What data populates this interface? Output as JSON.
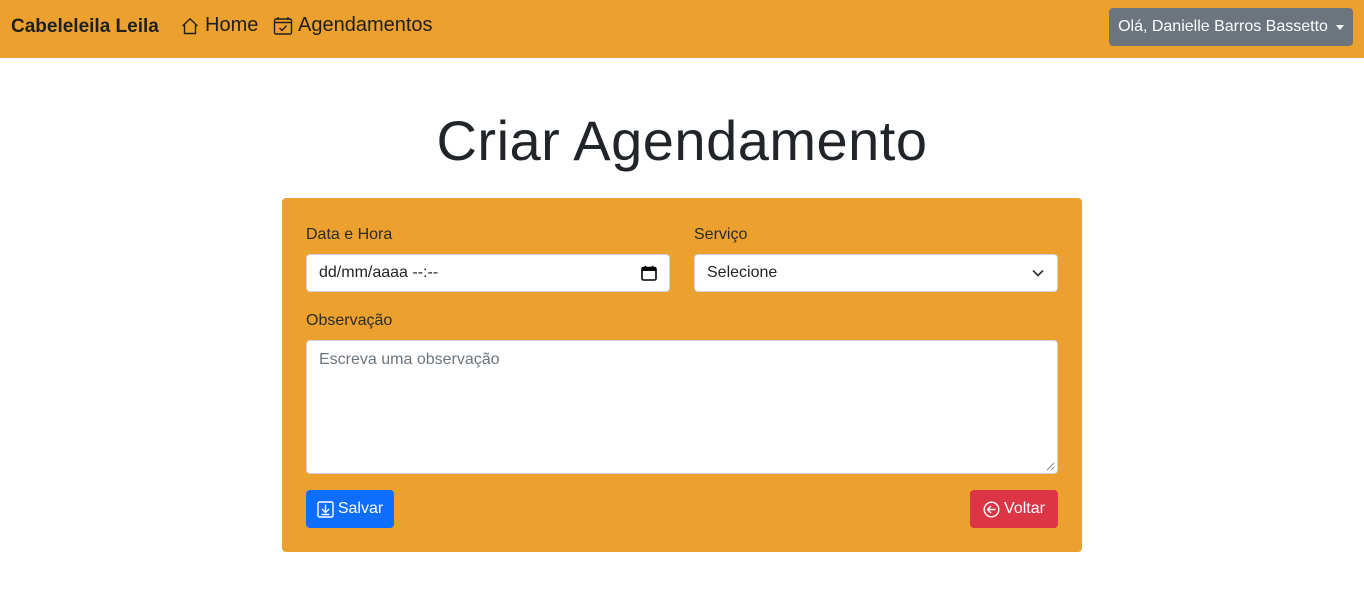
{
  "navbar": {
    "brand": "Cabeleleila Leila",
    "links": [
      {
        "label": "Home",
        "icon": "house-icon"
      },
      {
        "label": "Agendamentos",
        "icon": "calendar-check-icon"
      }
    ],
    "user_menu": {
      "label": "Olá, Danielle Barros Bassetto",
      "icon": "caret-down-icon"
    },
    "background_color": "#eca12f"
  },
  "page": {
    "title": "Criar Agendamento"
  },
  "form": {
    "background_color": "#eca12f",
    "datetime": {
      "label": "Data e Hora",
      "value": "dd/mm/aaaa --:--",
      "icon": "calendar-icon"
    },
    "service": {
      "label": "Serviço",
      "selected": "Selecione",
      "icon": "chevron-down-icon"
    },
    "observation": {
      "label": "Observação",
      "placeholder": "Escreva uma observação",
      "value": ""
    },
    "save_button": {
      "label": "Salvar",
      "icon": "download-box-icon",
      "color": "#0d6efd"
    },
    "back_button": {
      "label": "Voltar",
      "icon": "arrow-left-circle-icon",
      "color": "#dc3545"
    }
  }
}
